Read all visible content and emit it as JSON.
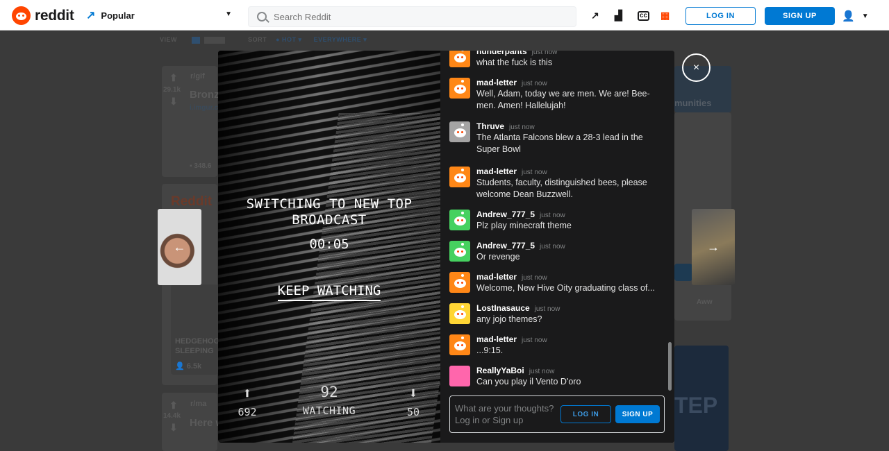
{
  "header": {
    "logo_text": "reddit",
    "feed_label": "Popular",
    "search_placeholder": "Search Reddit",
    "login_label": "LOG IN",
    "signup_label": "SIGN UP"
  },
  "background": {
    "view_label": "VIEW",
    "sort_label": "SORT",
    "sort_value": "HOT",
    "location_value": "EVERYWHERE",
    "post1_votes": "29.1k",
    "post1_sub": "r/gif",
    "post1_title": "Bronz",
    "post1_domain": "i.imgur.co",
    "post1_comments": "348.6",
    "post2_votes": "14.4k",
    "post2_sub": "r/ma",
    "post2_title": "Here w",
    "trending_label": "Reddit",
    "card_title": "HEDGEHOG SLEEPING",
    "card_count": "6.5k",
    "right_label": "munities",
    "right_label2": "Aww",
    "ad_text": "TEP"
  },
  "broadcast": {
    "switch_line1": "SWITCHING TO NEW TOP",
    "switch_line2": "BROADCAST",
    "countdown": "00:05",
    "keep_watching": "KEEP WATCHING",
    "upvotes": "692",
    "watching_count": "92",
    "watching_label": "WATCHING",
    "downvotes": "50"
  },
  "chat": {
    "messages": [
      {
        "user": "hunderpants",
        "time": "just now",
        "text": "what the fuck is this",
        "color": "#ff8717"
      },
      {
        "user": "mad-letter",
        "time": "just now",
        "text": "Well, Adam, today we are men. We are! Bee-men. Amen! Hallelujah!",
        "color": "#ff8717"
      },
      {
        "user": "Thruve",
        "time": "just now",
        "text": "The Atlanta Falcons blew a 28-3 lead in the Super Bowl",
        "color": "#a5a4a4"
      },
      {
        "user": "mad-letter",
        "time": "just now",
        "text": "Students, faculty, distinguished bees, please welcome Dean Buzzwell.",
        "color": "#ff8717"
      },
      {
        "user": "Andrew_777_5",
        "time": "just now",
        "text": "Plz play minecraft theme",
        "color": "#46d160"
      },
      {
        "user": "Andrew_777_5",
        "time": "just now",
        "text": "Or revenge",
        "color": "#46d160"
      },
      {
        "user": "mad-letter",
        "time": "just now",
        "text": "Welcome, New Hive Oity graduating class of...",
        "color": "#ff8717"
      },
      {
        "user": "LostInasauce",
        "time": "just now",
        "text": "any jojo themes?",
        "color": "#ffd635"
      },
      {
        "user": "mad-letter",
        "time": "just now",
        "text": "...9:15.",
        "color": "#ff8717"
      },
      {
        "user": "ReallyYaBoi",
        "time": "just now",
        "text": "Can you play il Vento D'oro",
        "color": "#ff66ac"
      }
    ],
    "input_placeholder": "What are your thoughts? Log in or Sign up",
    "login_label": "LOG IN",
    "signup_label": "SIGN UP"
  },
  "controls": {
    "close_glyph": "×",
    "prev_glyph": "←",
    "next_glyph": "→"
  }
}
